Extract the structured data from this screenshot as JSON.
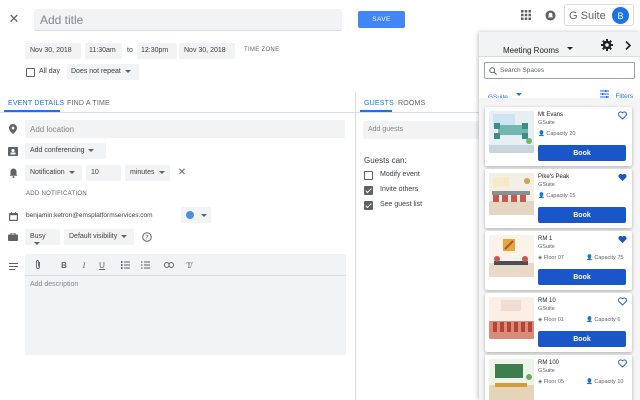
{
  "title_placeholder": "Add title",
  "save_label": "SAVE",
  "start_date": "Nov 30, 2018",
  "start_time": "11:30am",
  "to_label": "to",
  "end_time": "12:30pm",
  "end_date": "Nov 30, 2018",
  "timezone_label": "TIME ZONE",
  "allday_label": "All day",
  "repeat_label": "Does not repeat",
  "tabs": {
    "event_details": "EVENT DETAILS",
    "find_time": "FIND A TIME",
    "guests": "GUESTS",
    "rooms": "ROOMS"
  },
  "location_placeholder": "Add location",
  "conferencing_label": "Add conferencing",
  "notification": {
    "type": "Notification",
    "value": "10",
    "unit": "minutes"
  },
  "add_notification_label": "ADD NOTIFICATION",
  "calendar_owner": "benjamin.ketron@emsplatformservices.com",
  "busy_label": "Busy",
  "visibility_label": "Default visibility",
  "description_placeholder": "Add description",
  "guests_placeholder": "Add guests",
  "guests_can_label": "Guests can:",
  "guest_perms": [
    "Modify event",
    "Invite others",
    "See guest list"
  ],
  "topbar": {
    "gsuite_label": "G Suite",
    "avatar_letter": "B"
  },
  "panel": {
    "title": "Meeting Rooms",
    "search_placeholder": "Search Spaces",
    "source": "GSuite",
    "filters_label": "Filters",
    "book_label": "Book",
    "rooms": [
      {
        "name": "Mt Evans",
        "source": "GSuite",
        "floor": "",
        "capacity": "Capacity 20",
        "favorite": false
      },
      {
        "name": "Pike's Peak",
        "source": "GSuite",
        "floor": "",
        "capacity": "Capacity 15",
        "favorite": true
      },
      {
        "name": "RM 1",
        "source": "GSuite",
        "floor": "Floor 07",
        "capacity": "Capacity 75",
        "favorite": true
      },
      {
        "name": "RM 10",
        "source": "GSuite",
        "floor": "Floor 01",
        "capacity": "Capacity 6",
        "favorite": false
      },
      {
        "name": "RM 100",
        "source": "GSuite",
        "floor": "Floor 05",
        "capacity": "Capacity 10",
        "favorite": false
      }
    ]
  },
  "colors": {
    "accent": "#1a73e8",
    "book": "#1a56c8",
    "save": "#4285f4",
    "avatar": "#1a73e8"
  }
}
